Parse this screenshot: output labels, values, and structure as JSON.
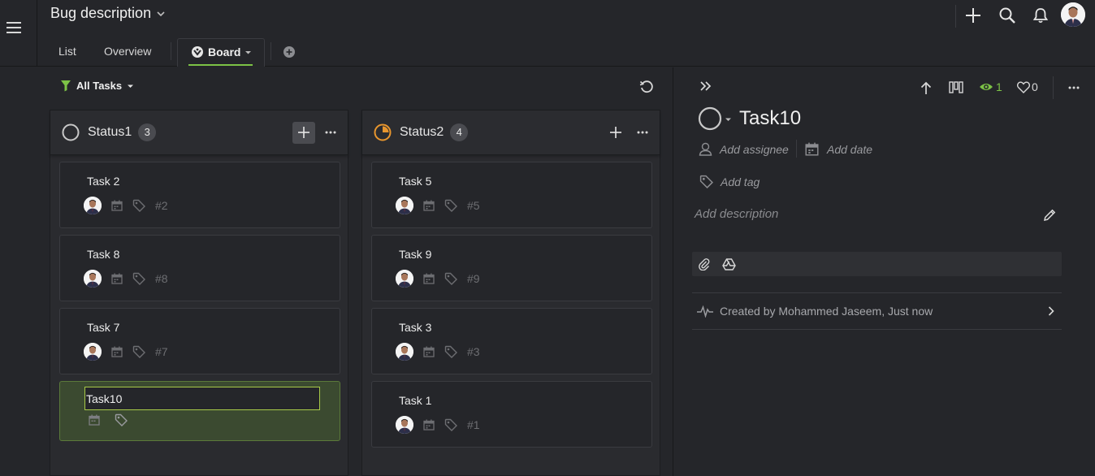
{
  "header": {
    "title": "Bug description",
    "tabs": {
      "list": "List",
      "overview": "Overview",
      "board": "Board"
    }
  },
  "toolbar": {
    "filter_label": "All Tasks"
  },
  "columns": [
    {
      "name": "Status1",
      "count": "3",
      "color": "#c8c8c8",
      "cards": [
        {
          "title": "Task 2",
          "num": "#2"
        },
        {
          "title": "Task 8",
          "num": "#8"
        },
        {
          "title": "Task 7",
          "num": "#7"
        }
      ],
      "new_task_value": "Task10"
    },
    {
      "name": "Status2",
      "count": "4",
      "color": "#e8962e",
      "cards": [
        {
          "title": "Task 5",
          "num": "#5"
        },
        {
          "title": "Task 9",
          "num": "#9"
        },
        {
          "title": "Task 3",
          "num": "#3"
        },
        {
          "title": "Task 1",
          "num": "#1"
        }
      ]
    }
  ],
  "detail": {
    "watchers": "1",
    "likes": "0",
    "task_title": "Task10",
    "add_assignee": "Add assignee",
    "add_date": "Add date",
    "add_tag": "Add tag",
    "add_description": "Add description",
    "activity": "Created by Mohammed Jaseem, Just now"
  },
  "colors": {
    "accent": "#7cc246",
    "background": "#25262a",
    "new_card": "#3b4a30"
  }
}
